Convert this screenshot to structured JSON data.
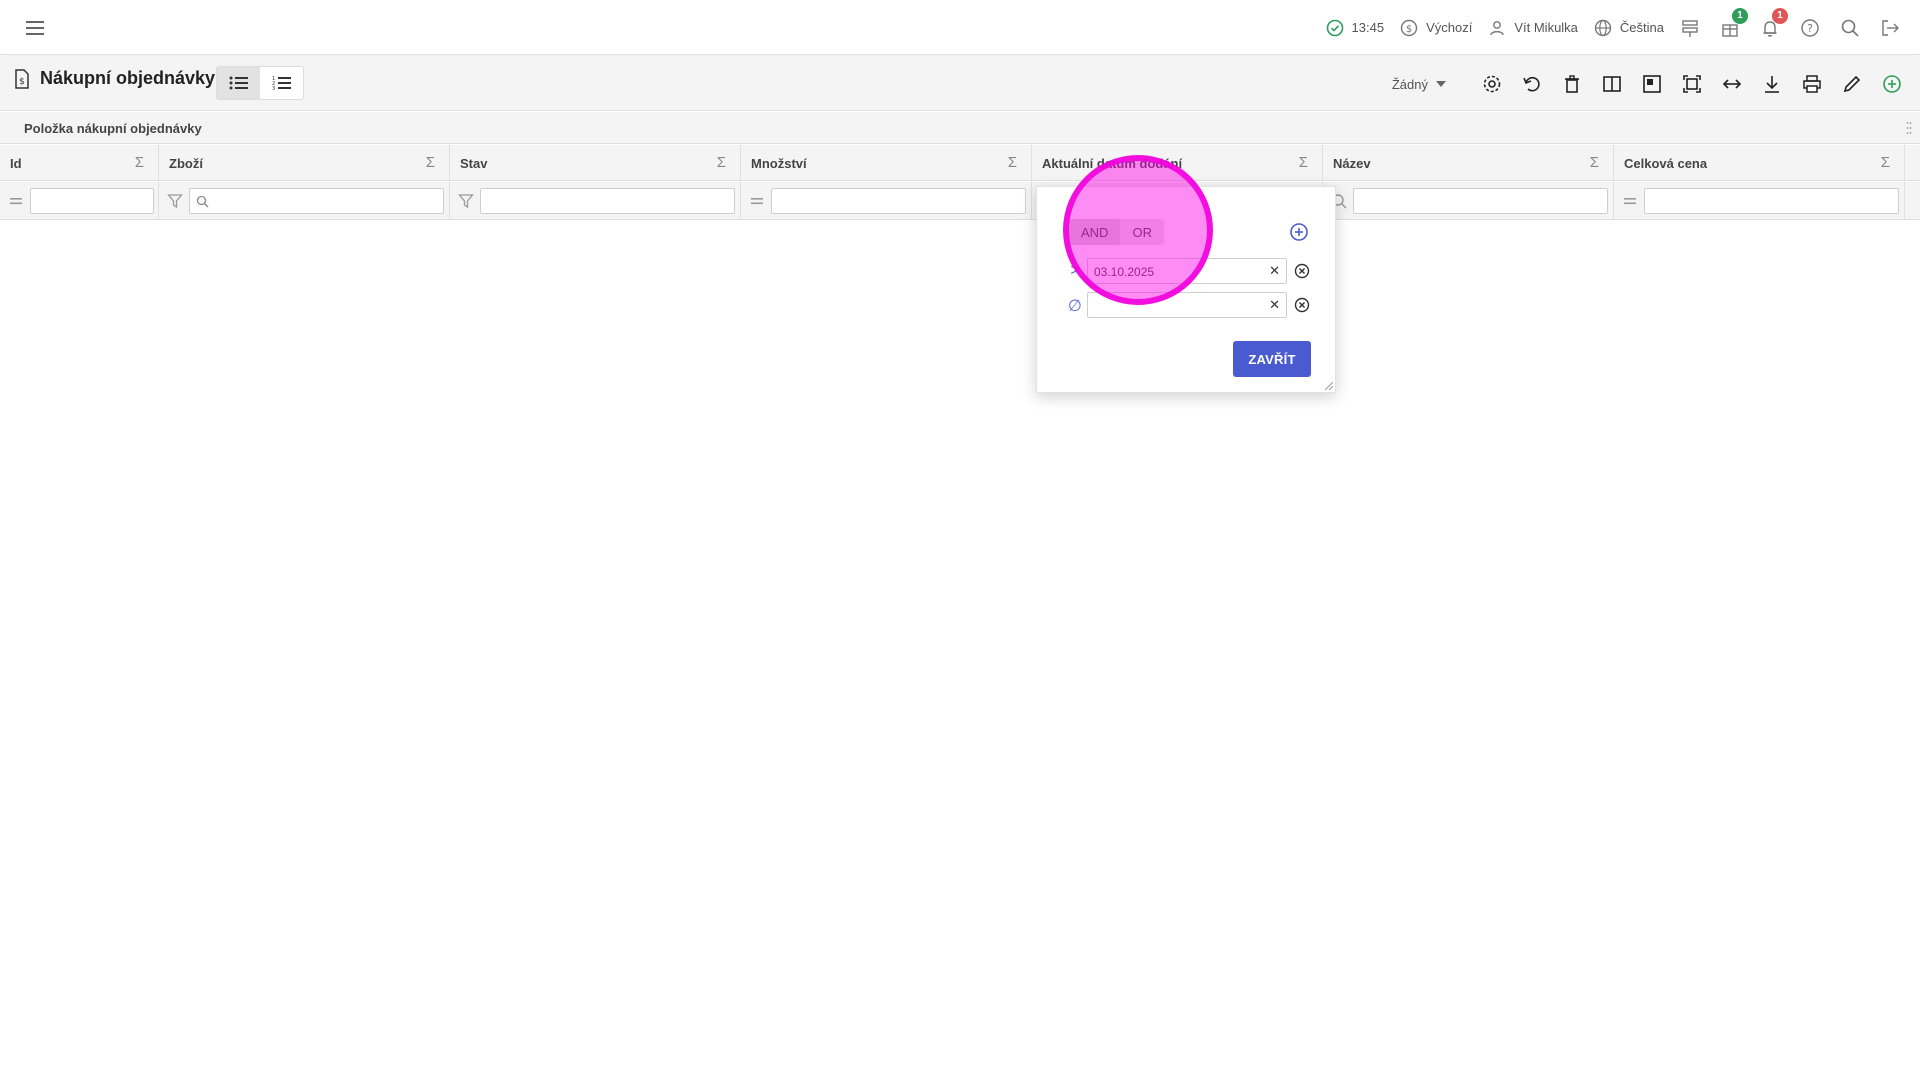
{
  "topbar": {
    "time": "13:45",
    "currency": "Výchozí",
    "user": "Vít Mikulka",
    "language": "Čeština",
    "gift_badge": "1",
    "notification_badge": "1",
    "colors": {
      "ok": "#2e9e5b",
      "gift_badge": "#2e9e5b",
      "notification_badge": "#e05555"
    }
  },
  "toolbar": {
    "title": "Nákupní objednávky",
    "selector_value": "Žádný"
  },
  "grid": {
    "group_label": "Položka nákupní objednávky",
    "columns": [
      {
        "label": "Id"
      },
      {
        "label": "Zboží"
      },
      {
        "label": "Stav"
      },
      {
        "label": "Množství"
      },
      {
        "label": "Aktuální datum dodání"
      },
      {
        "label": "Název"
      },
      {
        "label": "Celková cena"
      }
    ],
    "sigma": "Σ"
  },
  "popup": {
    "logic_and": "AND",
    "logic_or": "OR",
    "conditions": [
      {
        "operator": ">",
        "value": "03.10.2025"
      },
      {
        "operator": "∅",
        "value": ""
      }
    ],
    "clear_glyph": "✕",
    "close_label": "ZAVŘÍT",
    "accent": "#4a5bd0"
  }
}
